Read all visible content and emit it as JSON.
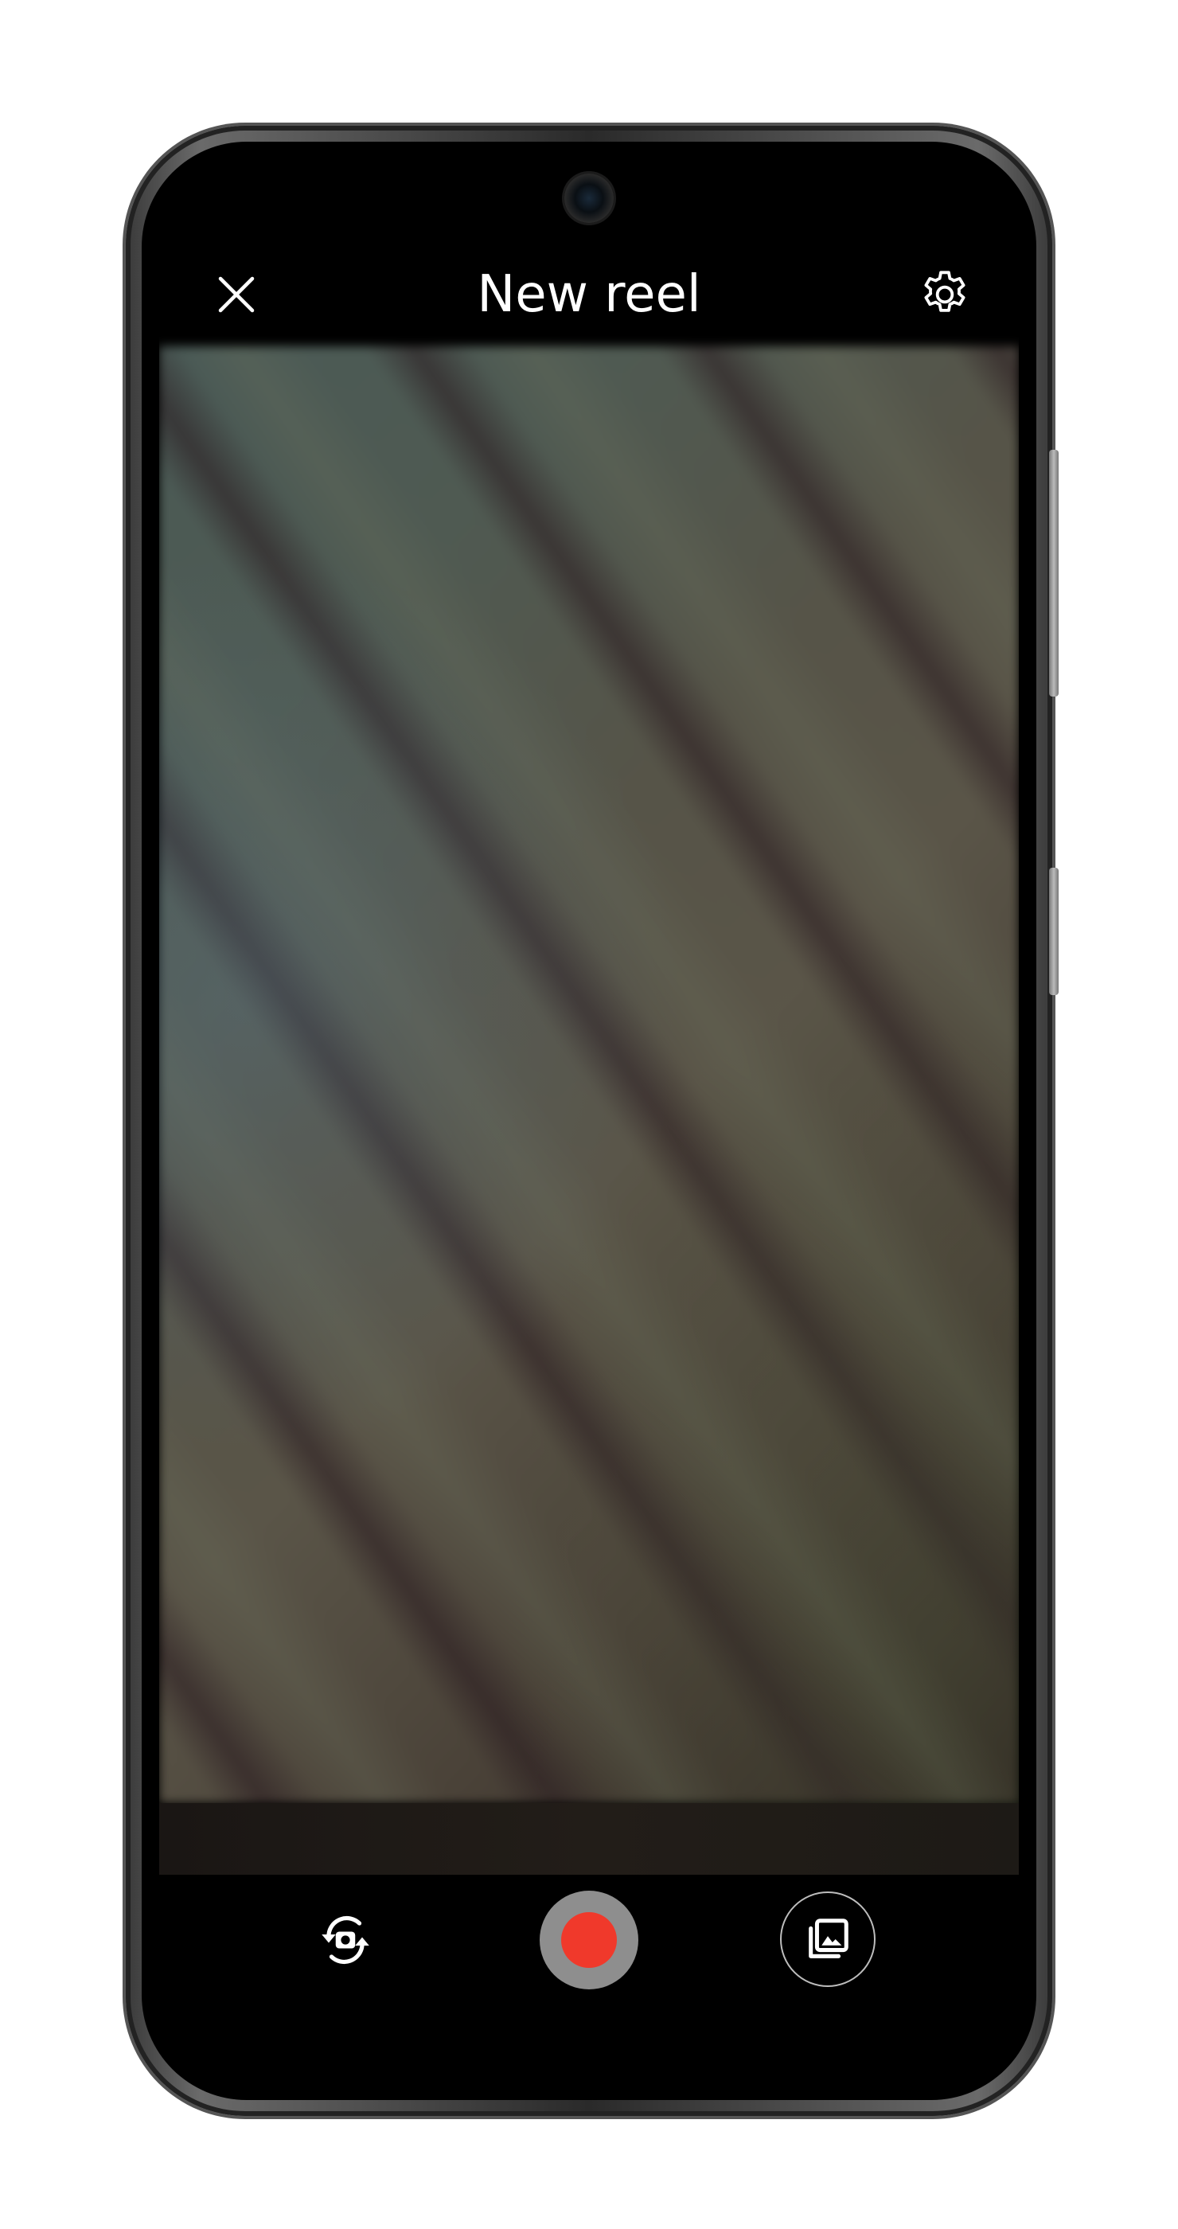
{
  "app_bar": {
    "title": "New reel",
    "close_icon": "close-icon",
    "settings_icon": "gear-icon"
  },
  "controls": {
    "flip_icon": "flip-camera-icon",
    "record_icon": "record-icon",
    "gallery_icon": "gallery-icon"
  },
  "colors": {
    "record": "#f0392b",
    "record_ring": "#8e8e8e",
    "text": "#ffffff",
    "background": "#000000"
  }
}
